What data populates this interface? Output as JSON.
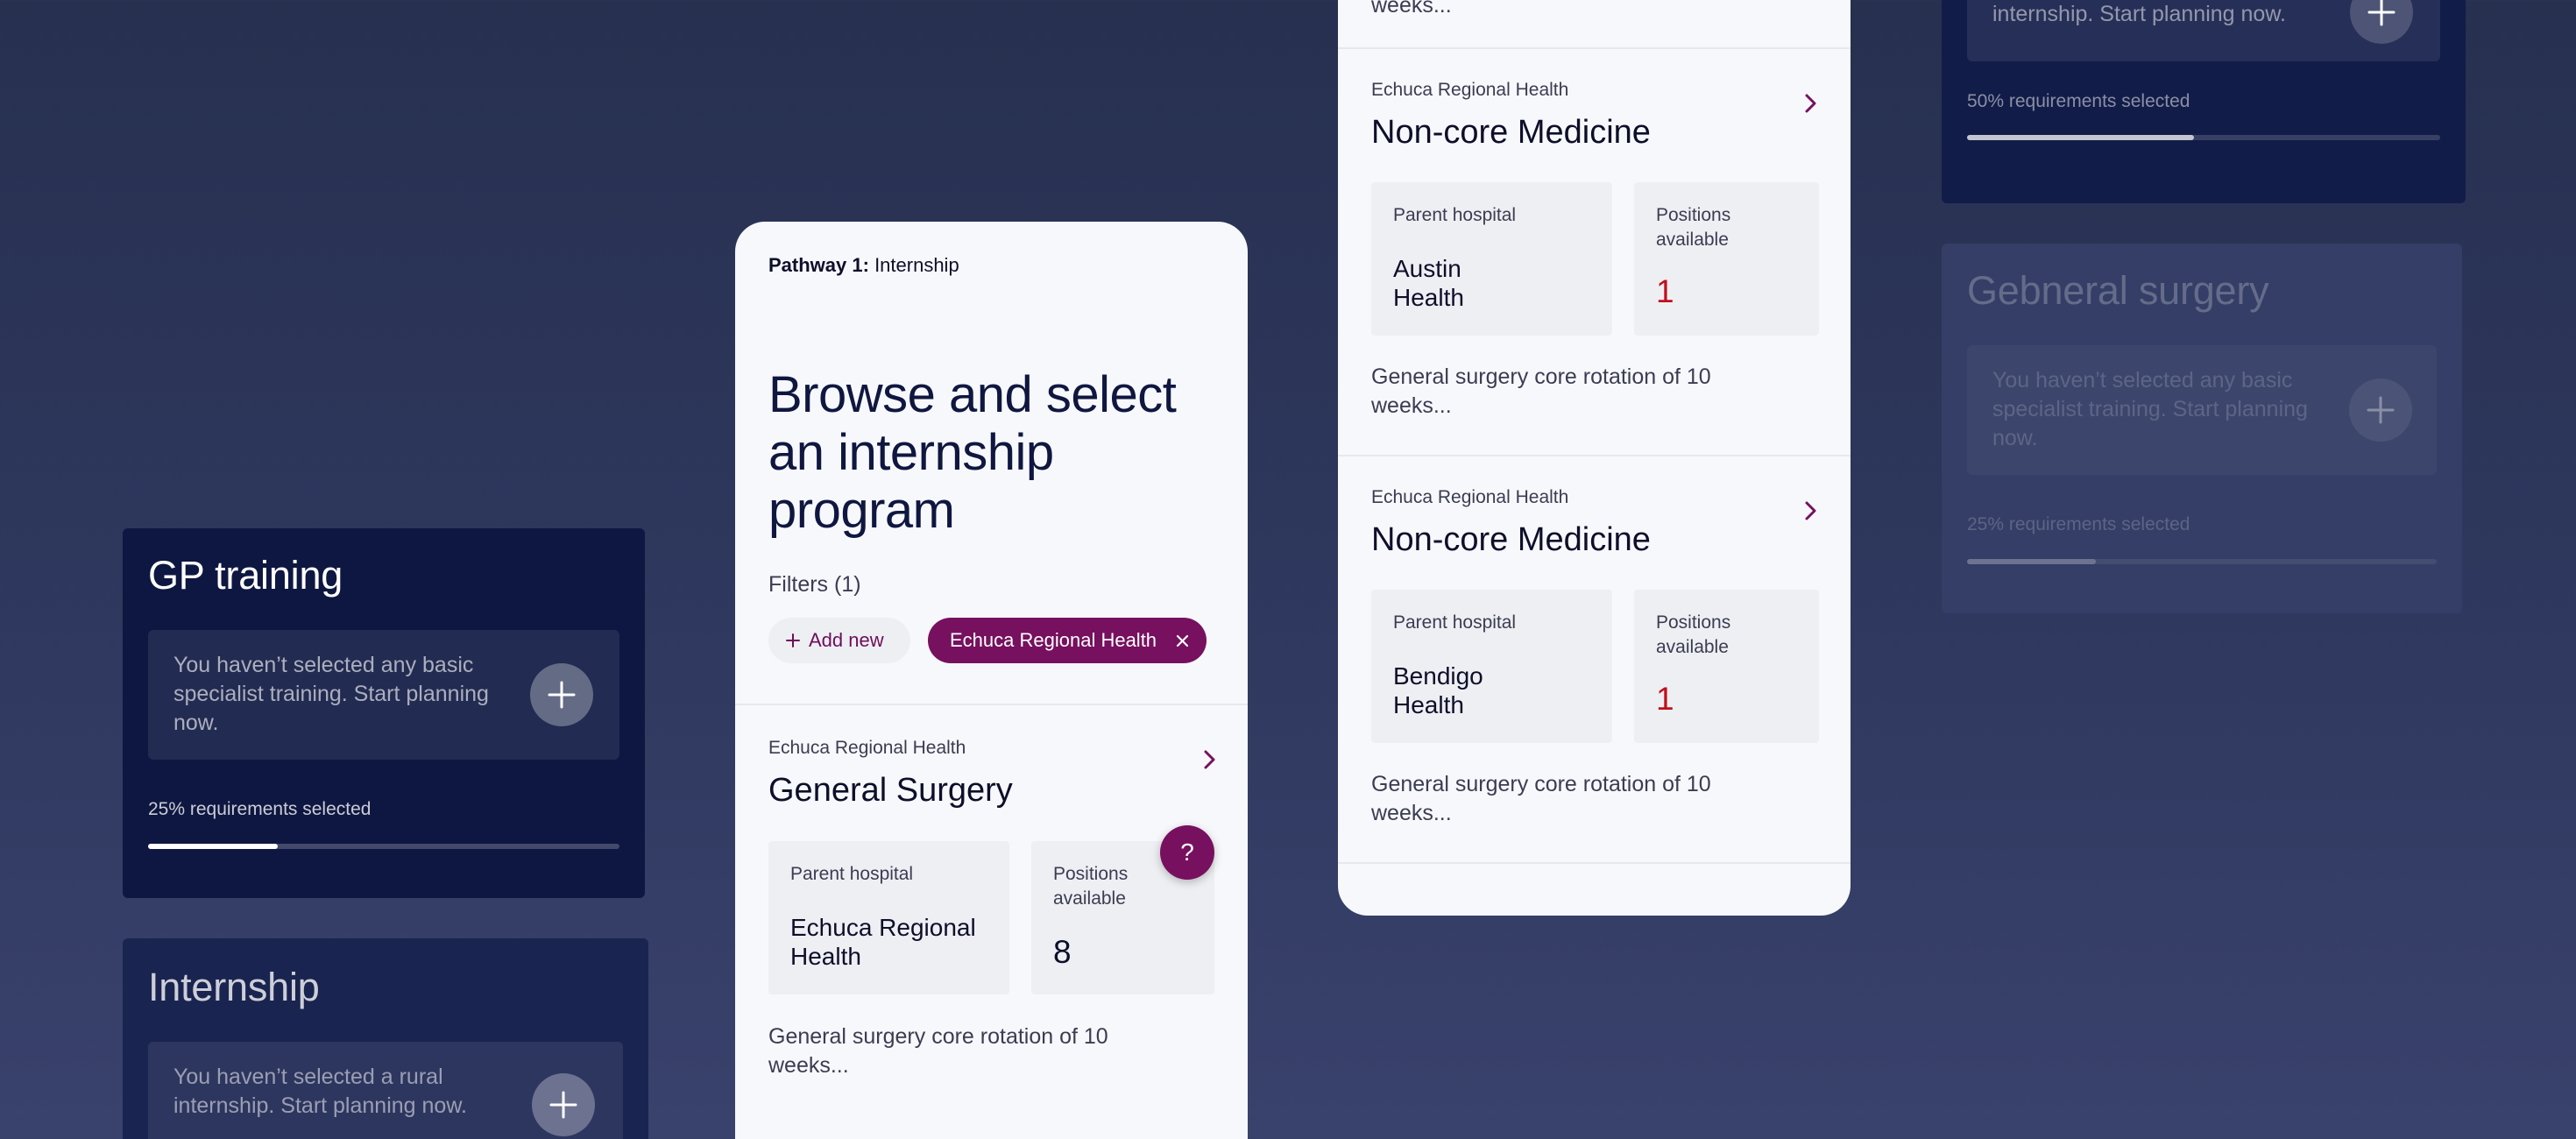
{
  "left_cards": {
    "gp": {
      "title": "GP training",
      "message": "You haven’t selected any basic specialist training. Start planning now.",
      "requirements": "25% requirements selected",
      "progress": 0.275
    },
    "internship": {
      "title": "Internship",
      "message": "You haven’t selected a rural internship. Start planning now."
    }
  },
  "right_cards": {
    "top": {
      "message": "internship. Start planning now.",
      "requirements": "50% requirements selected",
      "progress": 0.48
    },
    "surgery": {
      "title": "Gebneral surgery",
      "message": "You haven’t selected any basic specialist training. Start planning now.",
      "requirements": "25% requirements selected",
      "progress": 0.275
    }
  },
  "browse_panel": {
    "pathway_label": "Pathway 1:",
    "pathway_name": "Internship",
    "headline": "Browse and select an internship program",
    "filters_label": "Filters (1)",
    "add_new_label": "Add new",
    "active_filter": "Echuca Regional Health",
    "program": {
      "organisation": "Echuca Regional Health",
      "name": "General Surgery",
      "parent_hospital_label": "Parent hospital",
      "parent_hospital": "Echuca Regional Health",
      "positions_label": "Positions available",
      "positions": "8",
      "description": "General surgery core rotation of 10 weeks..."
    },
    "help_label": "?"
  },
  "list_panel": {
    "top_text": "weeks...",
    "programs": [
      {
        "organisation": "Echuca Regional Health",
        "name": "Non-core Medicine",
        "parent_hospital_label": "Parent hospital",
        "parent_hospital": "Austin Health",
        "positions_label": "Positions available",
        "positions": "1",
        "description": "General surgery core rotation of 10 weeks..."
      },
      {
        "organisation": "Echuca Regional Health",
        "name": "Non-core Medicine",
        "parent_hospital_label": "Parent hospital",
        "parent_hospital": "Bendigo Health",
        "positions_label": "Positions available",
        "positions": "1",
        "description": "General surgery core rotation of 10 weeks..."
      }
    ]
  },
  "colors": {
    "brand": "#77105f",
    "alert": "#c0101a",
    "navy_card": "#0e1741"
  },
  "icons": [
    "plus-icon",
    "close-icon",
    "chevron-right-icon",
    "help-icon"
  ]
}
